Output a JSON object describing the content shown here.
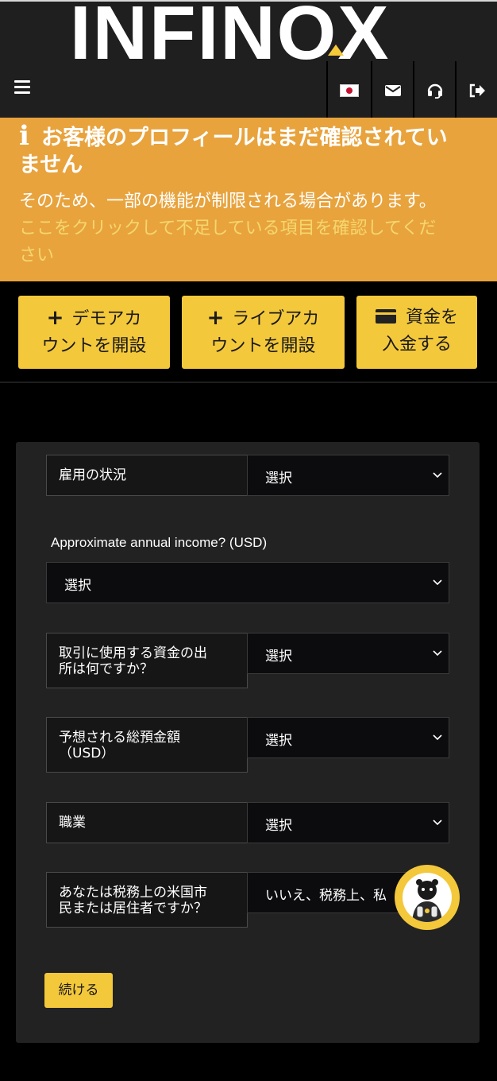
{
  "header": {
    "logo": "INFINOX",
    "icons": [
      "menu-icon",
      "japan-flag-icon",
      "mail-icon",
      "headset-icon",
      "logout-icon"
    ]
  },
  "alert": {
    "title_line1": "お客様のプロフィールはまだ確認されてい",
    "title_line2": "ません",
    "desc": "そのため、一部の機能が制限される場合があります。",
    "link_line1": "ここをクリックして不足している項目を確認してくだ",
    "link_line2": "さい"
  },
  "actions": {
    "demo_line1": "デモアカ",
    "demo_line2": "ウントを開設",
    "live_line1": "ライブアカ",
    "live_line2": "ウントを開設",
    "fund_line1": "資金を",
    "fund_line2": "入金する"
  },
  "form": {
    "employment_label": "雇用の状況",
    "employment_value": "選択",
    "income_label": "Approximate annual income? (USD)",
    "income_value": "選択",
    "source_label_line1": "取引に使用する資金の出",
    "source_label_line2": "所は何ですか？",
    "source_value": "選択",
    "deposit_label_line1": "予想される総預金額",
    "deposit_label_line2": "（USD）",
    "deposit_value": "選択",
    "occupation_label": "職業",
    "occupation_value": "選択",
    "us_label_line1": "あなたは税務上の米国市",
    "us_label_line2": "民または居住者ですか？",
    "us_value": "いいえ、税務上、私",
    "continue_label": "続ける"
  },
  "colors": {
    "accent": "#f4c83b",
    "alert_bg": "#e8a33d",
    "panel_bg": "#222222"
  }
}
